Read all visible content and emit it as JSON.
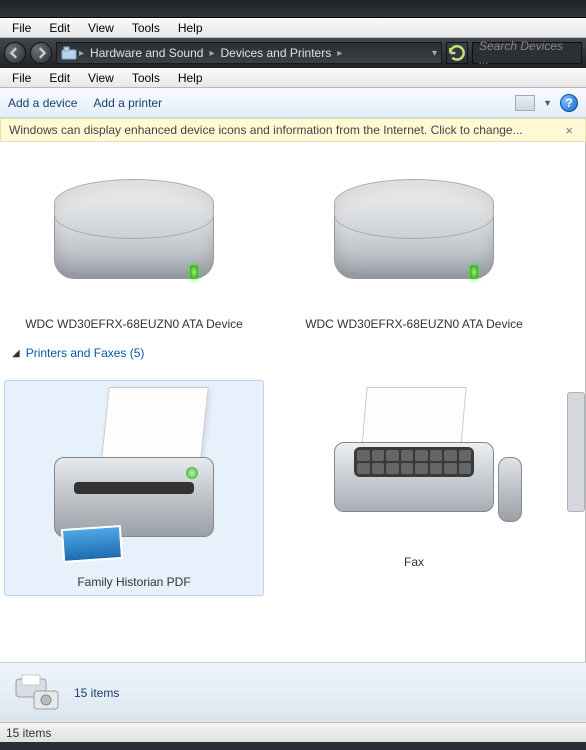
{
  "menus": [
    "File",
    "Edit",
    "View",
    "Tools",
    "Help"
  ],
  "breadcrumb": {
    "parent": "Hardware and Sound",
    "current": "Devices and Printers"
  },
  "search": {
    "placeholder": "Search Devices ..."
  },
  "toolbar": {
    "add_device": "Add a device",
    "add_printer": "Add a printer"
  },
  "infobar": {
    "text": "Windows can display enhanced device icons and information from the Internet. Click to change...",
    "close": "×"
  },
  "devices": {
    "hdd1": "WDC WD30EFRX-68EUZN0 ATA Device",
    "hdd2": "WDC WD30EFRX-68EUZN0 ATA Device"
  },
  "group": {
    "printers_faxes_label": "Printers and Faxes (5)"
  },
  "printers": {
    "fh_pdf": "Family Historian PDF",
    "fax": "Fax"
  },
  "details": {
    "count_label": "15 items"
  },
  "status": {
    "text": "15 items"
  }
}
